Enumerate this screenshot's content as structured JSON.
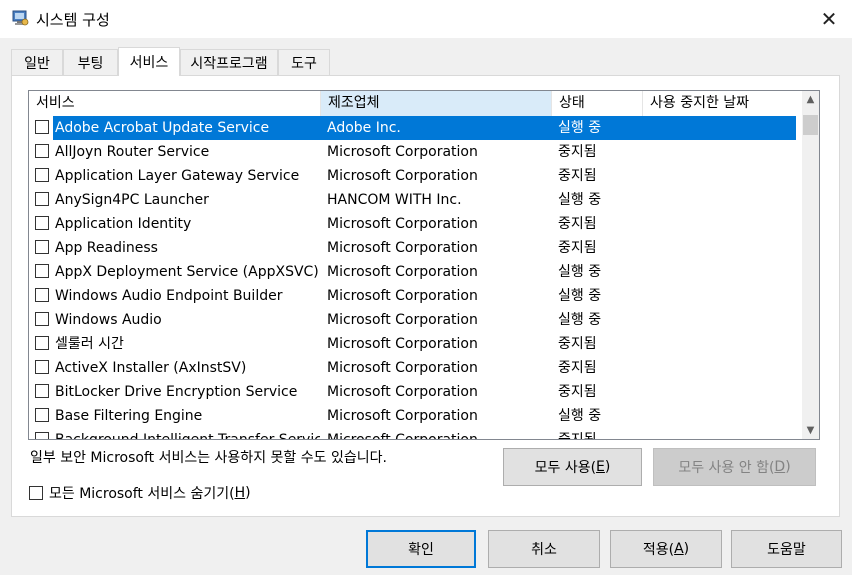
{
  "window": {
    "title": "시스템 구성",
    "close_glyph": "✕",
    "icon": "msconfig-icon"
  },
  "tabs": [
    "일반",
    "부팅",
    "서비스",
    "시작프로그램",
    "도구"
  ],
  "active_tab": "서비스",
  "list": {
    "columns": [
      "서비스",
      "제조업체",
      "상태",
      "사용 중지한 날짜"
    ],
    "sorted_column": "제조업체",
    "rows": [
      {
        "name": "Adobe Acrobat Update Service",
        "manufacturer": "Adobe Inc.",
        "status": "실행 중",
        "checked": false,
        "selected": true
      },
      {
        "name": "AllJoyn Router Service",
        "manufacturer": "Microsoft Corporation",
        "status": "중지됨",
        "checked": false
      },
      {
        "name": "Application Layer Gateway Service",
        "manufacturer": "Microsoft Corporation",
        "status": "중지됨",
        "checked": false
      },
      {
        "name": "AnySign4PC Launcher",
        "manufacturer": "HANCOM WITH Inc.",
        "status": "실행 중",
        "checked": false
      },
      {
        "name": "Application Identity",
        "manufacturer": "Microsoft Corporation",
        "status": "중지됨",
        "checked": false
      },
      {
        "name": "App Readiness",
        "manufacturer": "Microsoft Corporation",
        "status": "중지됨",
        "checked": false
      },
      {
        "name": "AppX Deployment Service (AppXSVC)",
        "manufacturer": "Microsoft Corporation",
        "status": "실행 중",
        "checked": false
      },
      {
        "name": "Windows Audio Endpoint Builder",
        "manufacturer": "Microsoft Corporation",
        "status": "실행 중",
        "checked": false
      },
      {
        "name": "Windows Audio",
        "manufacturer": "Microsoft Corporation",
        "status": "실행 중",
        "checked": false
      },
      {
        "name": "셀룰러 시간",
        "manufacturer": "Microsoft Corporation",
        "status": "중지됨",
        "checked": false
      },
      {
        "name": "ActiveX Installer (AxInstSV)",
        "manufacturer": "Microsoft Corporation",
        "status": "중지됨",
        "checked": false
      },
      {
        "name": "BitLocker Drive Encryption Service",
        "manufacturer": "Microsoft Corporation",
        "status": "중지됨",
        "checked": false
      },
      {
        "name": "Base Filtering Engine",
        "manufacturer": "Microsoft Corporation",
        "status": "실행 중",
        "checked": false
      },
      {
        "name": "Background Intelligent Transfer Service",
        "manufacturer": "Microsoft Corporation",
        "status": "중지됨",
        "checked": false
      }
    ]
  },
  "note": "일부 보안 Microsoft 서비스는 사용하지 못할 수도 있습니다.",
  "enable_all": {
    "label": "모두 사용(",
    "key": "E",
    "tail": ")"
  },
  "disable_all": {
    "label": "모두 사용 안 함(",
    "key": "D",
    "tail": ")"
  },
  "hide_ms": {
    "label": "모든 Microsoft 서비스 숨기기(",
    "key": "H",
    "tail": ")",
    "checked": false
  },
  "buttons": {
    "ok": "확인",
    "cancel": "취소",
    "apply": {
      "label": "적용(",
      "key": "A",
      "tail": ")"
    },
    "help": "도움말"
  },
  "colors": {
    "selection": "#0078d7",
    "sorted_header": "#d9ebf9"
  }
}
